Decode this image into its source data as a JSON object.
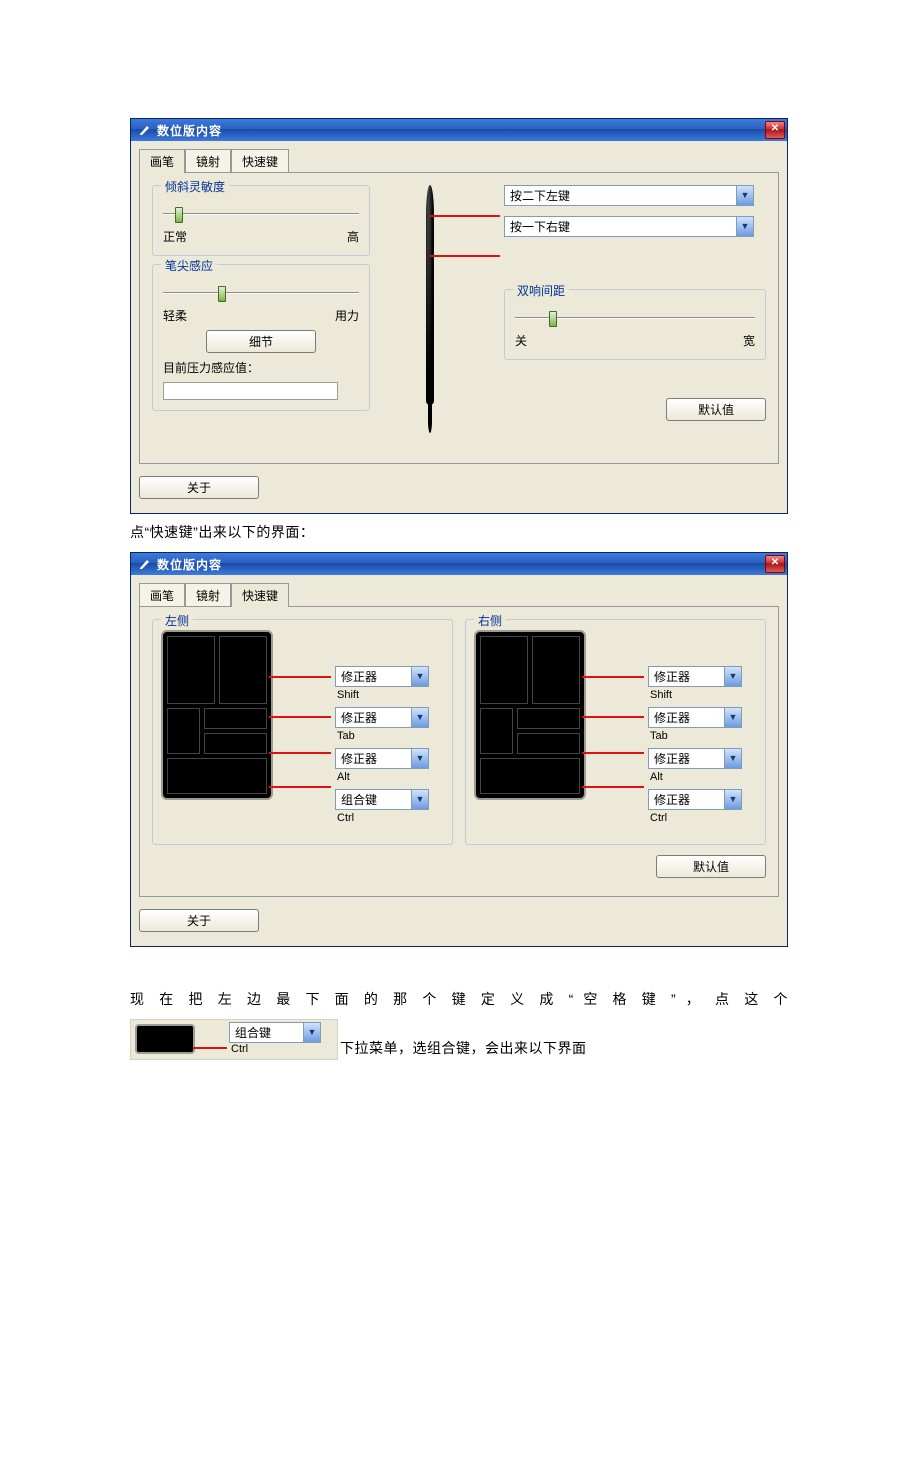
{
  "window_title": "数位版内容",
  "tabs": {
    "pen": "画笔",
    "map": "镜射",
    "quick": "快速键"
  },
  "window1": {
    "tilt": {
      "label": "倾斜灵敏度",
      "low": "正常",
      "high": "高"
    },
    "tip": {
      "label": "笔尖感应",
      "low": "轻柔",
      "high": "用力",
      "detail_btn": "细节"
    },
    "pressure_label": "目前压力感应值：",
    "combo_top": "按二下左键",
    "combo_mid": "按一下右键",
    "dbl": {
      "label": "双响间距",
      "low": "关",
      "high": "宽"
    },
    "defaults_btn": "默认值",
    "about_btn": "关于"
  },
  "window2": {
    "left_label": "左侧",
    "right_label": "右侧",
    "combos": {
      "modifier": "修正器",
      "combo_key": "组合键",
      "sub_shift": "Shift",
      "sub_tab": "Tab",
      "sub_alt": "Alt",
      "sub_ctrl": "Ctrl"
    },
    "defaults_btn": "默认值",
    "about_btn": "关于"
  },
  "doc": {
    "line1": "点“快速键”出来以下的界面：",
    "line2": "现 在 把 左 边 最 下 面 的 那 个 键 定 义 成 “ 空 格 键 ” ， 点 这 个",
    "line3": "下拉菜单，选组合键，会出来以下界面"
  }
}
